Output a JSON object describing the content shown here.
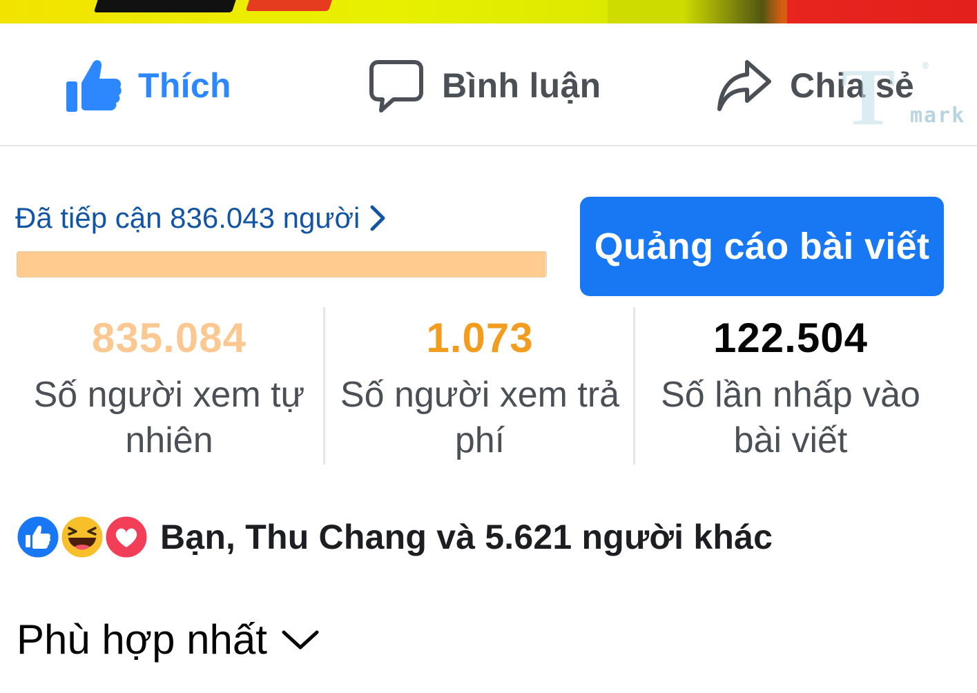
{
  "actions": {
    "like_label": "Thích",
    "comment_label": "Bình luận",
    "share_label": "Chia sẻ"
  },
  "watermark": {
    "text": "mark"
  },
  "reach": {
    "label": "Đã tiếp cận 836.043 người",
    "progress": 0.999
  },
  "promote_button": "Quảng cáo bài viết",
  "stats": [
    {
      "value": "835.084",
      "label": "Số người xem tự nhiên",
      "color": "#fcc892"
    },
    {
      "value": "1.073",
      "label": "Số người xem trả phí",
      "color": "#f29d1f"
    },
    {
      "value": "122.504",
      "label": "Số lần nhấp vào bài viết",
      "color": "#050505"
    }
  ],
  "reactions": {
    "icons": [
      "like-icon",
      "haha-icon",
      "love-icon"
    ],
    "summary": "Bạn, Thu Chang và 5.621 người khác"
  },
  "sort": {
    "label": "Phù hợp nhất"
  },
  "colors": {
    "accent": "#1877f2",
    "like_blue": "#2d88ff",
    "link_blue": "#1255a4"
  }
}
